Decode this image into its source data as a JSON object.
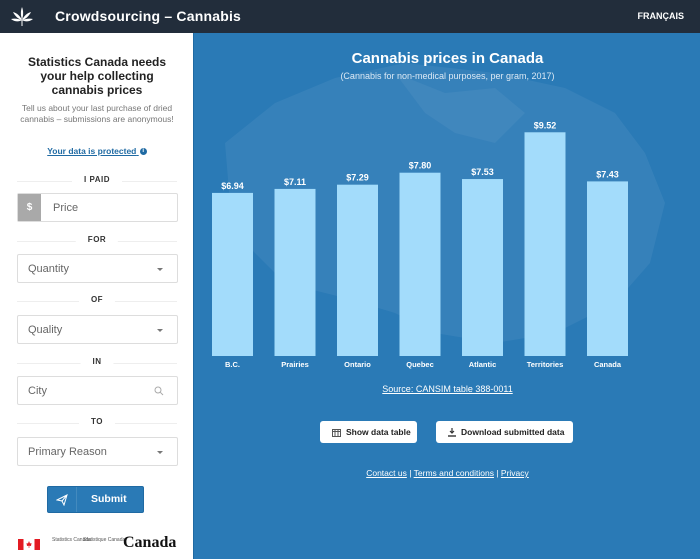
{
  "header": {
    "title": "Crowdsourcing – Cannabis",
    "language_toggle": "FRANÇAIS",
    "logo_icon": "cannabis-leaf-icon"
  },
  "sidebar": {
    "heading": "Statistics Canada needs your help collecting cannabis prices",
    "description": "Tell us about your last purchase of dried cannabis – submissions are anonymous!",
    "privacy_link": "Your data is protected",
    "privacy_icon": "info-icon",
    "sections": {
      "paid": "I PAID",
      "for": "FOR",
      "of": "OF",
      "in": "IN",
      "to": "TO"
    },
    "fields": {
      "price_addon": "$",
      "price_placeholder": "Price",
      "quantity": "Quantity",
      "quality": "Quality",
      "city_placeholder": "City",
      "reason": "Primary Reason"
    },
    "submit_label": "Submit",
    "footer": {
      "statcan_en": "Statistics Canada",
      "statcan_fr": "Statistique Canada",
      "wordmark": "Canada"
    }
  },
  "main": {
    "source_link": "Source: CANSIM table 388-0011",
    "show_table_button": "Show data table",
    "download_button": "Download submitted data",
    "footer_links": [
      "Contact us",
      "Terms and conditions",
      "Privacy"
    ],
    "colors": {
      "background": "#2a7ab6",
      "bar": "#a3dcfb",
      "header": "#222d3b"
    }
  },
  "chart_data": {
    "type": "bar",
    "title": "Cannabis prices in Canada",
    "subtitle": "(Cannabis for non-medical purposes, per gram, 2017)",
    "categories": [
      "B.C.",
      "Prairies",
      "Ontario",
      "Quebec",
      "Atlantic",
      "Territories",
      "Canada"
    ],
    "values": [
      6.94,
      7.11,
      7.29,
      7.8,
      7.53,
      9.52,
      7.43
    ],
    "labels": [
      "$6.94",
      "$7.11",
      "$7.29",
      "$7.80",
      "$7.53",
      "$9.52",
      "$7.43"
    ],
    "xlabel": "",
    "ylabel": "",
    "ylim": [
      0,
      10
    ],
    "grid": false,
    "legend": "none"
  }
}
